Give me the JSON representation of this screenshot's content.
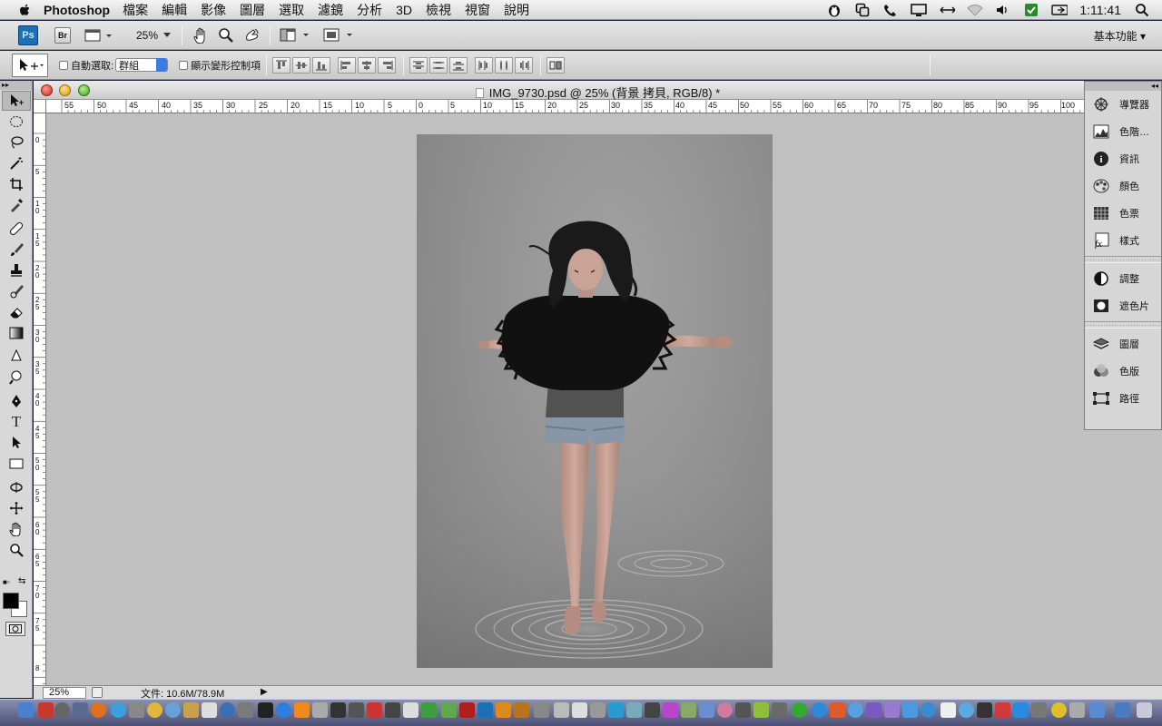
{
  "menubar": {
    "app_name": "Photoshop",
    "menus": [
      "檔案",
      "編輯",
      "影像",
      "圖層",
      "選取",
      "濾鏡",
      "分析",
      "3D",
      "檢視",
      "視窗",
      "說明"
    ],
    "clock": "1:11:41"
  },
  "appbar": {
    "ps_label": "Ps",
    "br_label": "Br",
    "zoom": "25%",
    "workspace": "基本功能"
  },
  "options": {
    "auto_select_label": "自動選取:",
    "auto_select_value": "群組",
    "show_transform_label": "顯示變形控制項"
  },
  "document": {
    "title": "IMG_9730.psd @ 25% (背景 拷貝, RGB/8) *",
    "zoom_field": "25%",
    "doc_size": "文件: 10.6M/78.9M",
    "h_ruler": [
      "55",
      "50",
      "45",
      "40",
      "35",
      "30",
      "25",
      "20",
      "15",
      "10",
      "5",
      "0",
      "5",
      "10",
      "15",
      "20",
      "25",
      "30",
      "35",
      "40",
      "45",
      "50",
      "55",
      "60",
      "65",
      "70",
      "75",
      "80",
      "85",
      "90",
      "95",
      "100"
    ],
    "v_ruler": [
      "0",
      "5",
      "1 0",
      "1 5",
      "2 0",
      "2 5",
      "3 0",
      "3 5",
      "4 0",
      "4 5",
      "5 0",
      "5 5",
      "6 0",
      "6 5",
      "7 0",
      "7 5",
      "8"
    ]
  },
  "panels": {
    "group1": [
      "導覽器",
      "色階…",
      "資訊",
      "顏色",
      "色票",
      "樣式"
    ],
    "group2": [
      "調整",
      "遮色片"
    ],
    "group3": [
      "圖層",
      "色版",
      "路徑"
    ]
  },
  "colors": {
    "ps_blue": "#1d6fb8",
    "canvas_bg": "#c0c0c0",
    "close_red": "#d0251a",
    "min_yellow": "#d99a0f",
    "max_green": "#3f9f1f"
  }
}
